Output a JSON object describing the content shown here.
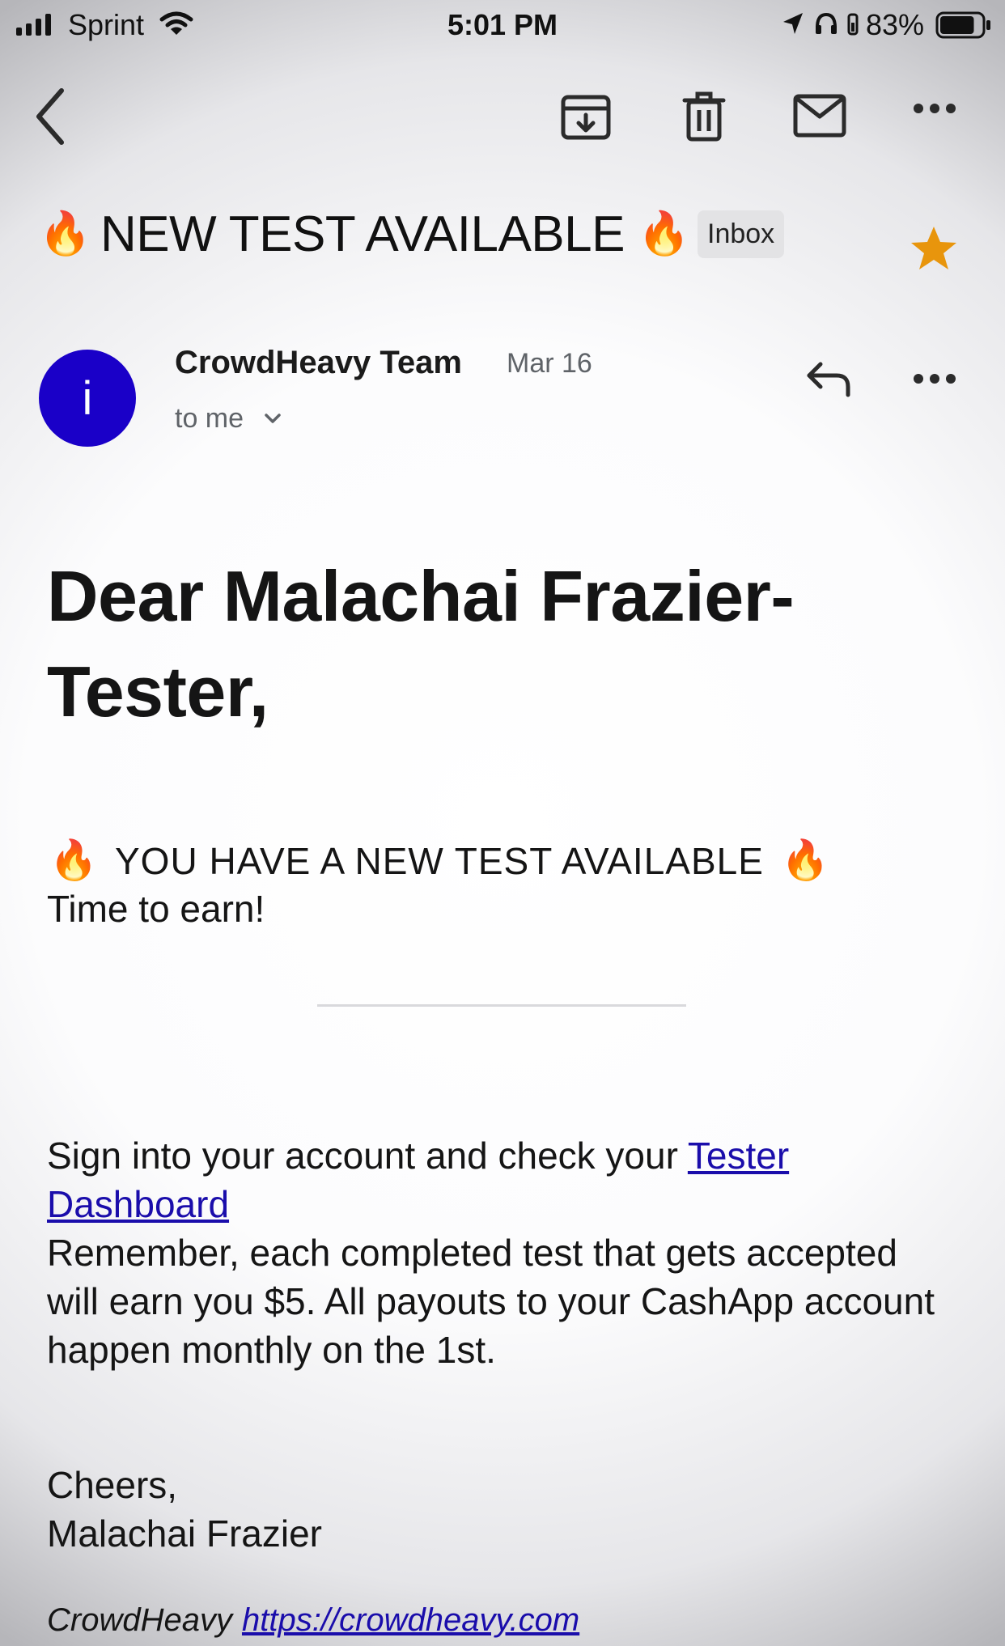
{
  "status_bar": {
    "carrier": "Sprint",
    "time": "5:01 PM",
    "battery_percent": "83%",
    "battery_level": 0.83,
    "icons": [
      "signal-icon",
      "wifi-icon",
      "location-icon",
      "headphone-icon",
      "lock-icon",
      "battery-icon"
    ]
  },
  "toolbar": {
    "icons": [
      "back-icon",
      "archive-icon",
      "delete-icon",
      "mail-icon",
      "more-icon"
    ]
  },
  "email": {
    "subject": "NEW TEST AVAILABLE",
    "subject_emoji": "🔥",
    "label": "Inbox",
    "starred": true,
    "star_color": "#e8950c",
    "sender": {
      "avatar_letter": "i",
      "avatar_color": "#1a00c8",
      "name": "CrowdHeavy Team",
      "date": "Mar 16",
      "recipient": "to me"
    },
    "body": {
      "greeting": "Dear Malachai Frazier-Tester,",
      "announcement": "YOU HAVE A NEW TEST AVAILABLE",
      "announcement_emoji": "🔥",
      "earn_line": "Time to earn!",
      "instruction_prefix": "Sign into your account and check your ",
      "dashboard_link": "Tester Dashboard",
      "reminder": "Remember, each completed test that gets accepted will earn you $5. All payouts to your CashApp account happen monthly on the 1st.",
      "signoff": "Cheers,",
      "signature": "Malachai Frazier",
      "footer_brand": "CrowdHeavy",
      "footer_link": "https://crowdheavy.com"
    }
  },
  "colors": {
    "link": "#1a0dab",
    "secondary_text": "#5f6368"
  }
}
